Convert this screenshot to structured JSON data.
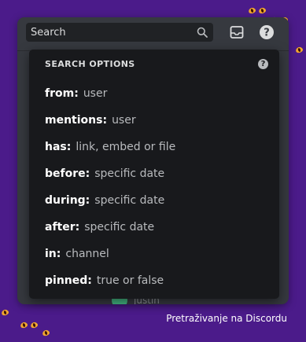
{
  "search": {
    "placeholder": "Search"
  },
  "popout": {
    "title": "SEARCH OPTIONS",
    "help_glyph": "?",
    "options": [
      {
        "key": "from:",
        "value": "user"
      },
      {
        "key": "mentions:",
        "value": "user"
      },
      {
        "key": "has:",
        "value": "link, embed or file"
      },
      {
        "key": "before:",
        "value": "specific date"
      },
      {
        "key": "during:",
        "value": "specific date"
      },
      {
        "key": "after:",
        "value": "specific date"
      },
      {
        "key": "in:",
        "value": "channel"
      },
      {
        "key": "pinned:",
        "value": "true or false"
      }
    ]
  },
  "background": {
    "username": "justin"
  },
  "caption": "Pretraživanje na Discordu",
  "icons": {
    "search": "search-icon",
    "inbox": "inbox-icon",
    "help": "help-icon"
  },
  "colors": {
    "background": "#4b1b8a",
    "window": "#36393f",
    "popout": "#18191c",
    "accent_eyes": "#f2a72f"
  }
}
